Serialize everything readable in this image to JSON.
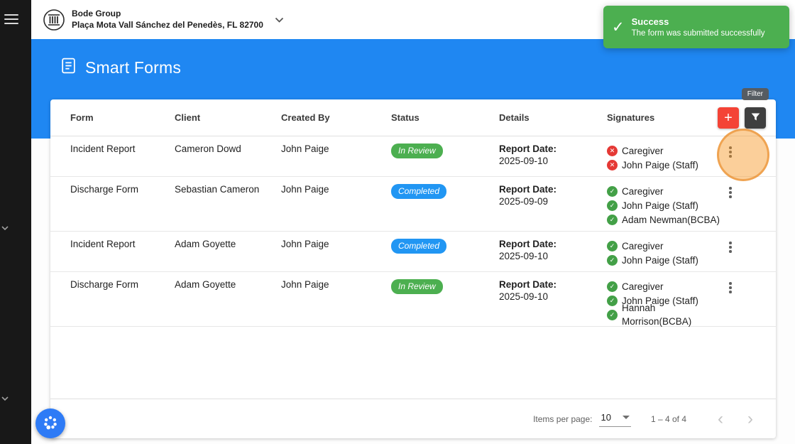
{
  "header": {
    "company_name": "Bode Group",
    "company_address": "Plaça Mota Vall Sánchez del Penedès, FL 82700"
  },
  "toast": {
    "title": "Success",
    "message": "The form was submitted successfully"
  },
  "page": {
    "title": "Smart Forms"
  },
  "filter_tooltip": "Filter",
  "table": {
    "columns": {
      "form": "Form",
      "client": "Client",
      "created_by": "Created By",
      "status": "Status",
      "details": "Details",
      "signatures": "Signatures"
    },
    "add_button_label": "+",
    "rows": [
      {
        "form": "Incident Report",
        "client": "Cameron Dowd",
        "created_by": "John Paige",
        "status": "In Review",
        "status_type": "in-review",
        "details_label": "Report Date:",
        "details_date": "2025-09-10",
        "signatures": [
          {
            "name": "Caregiver",
            "signed": false
          },
          {
            "name": "John Paige (Staff)",
            "signed": false
          }
        ]
      },
      {
        "form": "Discharge Form",
        "client": "Sebastian Cameron",
        "created_by": "John Paige",
        "status": "Completed",
        "status_type": "completed",
        "details_label": "Report Date:",
        "details_date": "2025-09-09",
        "signatures": [
          {
            "name": "Caregiver",
            "signed": true
          },
          {
            "name": "John Paige (Staff)",
            "signed": true
          },
          {
            "name": "Adam Newman(BCBA)",
            "signed": true
          }
        ]
      },
      {
        "form": "Incident Report",
        "client": "Adam Goyette",
        "created_by": "John Paige",
        "status": "Completed",
        "status_type": "completed",
        "details_label": "Report Date:",
        "details_date": "2025-09-10",
        "signatures": [
          {
            "name": "Caregiver",
            "signed": true
          },
          {
            "name": "John Paige (Staff)",
            "signed": true
          }
        ]
      },
      {
        "form": "Discharge Form",
        "client": "Adam Goyette",
        "created_by": "John Paige",
        "status": "In Review",
        "status_type": "in-review",
        "details_label": "Report Date:",
        "details_date": "2025-09-10",
        "signatures": [
          {
            "name": "Caregiver",
            "signed": true
          },
          {
            "name": "John Paige (Staff)",
            "signed": true
          },
          {
            "name": "Hannah Morrison(BCBA)",
            "signed": true
          }
        ]
      }
    ]
  },
  "pagination": {
    "items_per_page_label": "Items per page:",
    "items_per_page_value": "10",
    "range_label": "1 – 4 of 4"
  },
  "colors": {
    "accent_blue": "#1f87f2",
    "success_green": "#4caf50",
    "signed_green": "#43a047",
    "error_red": "#e53935",
    "add_button_red": "#f44336",
    "completed_blue": "#2196f3"
  }
}
